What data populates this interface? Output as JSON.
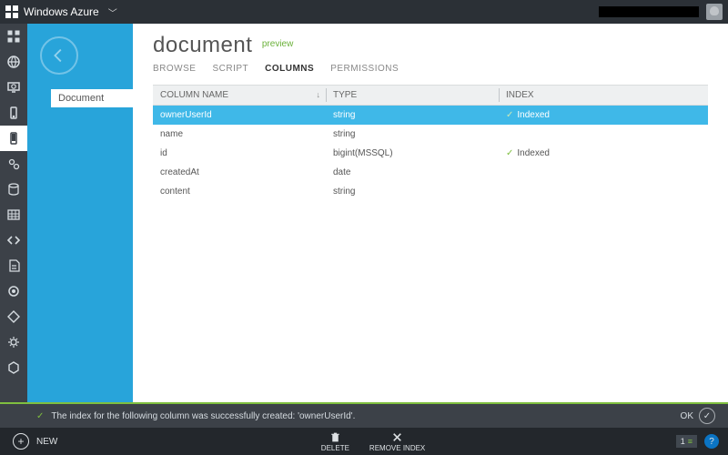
{
  "brand": "Windows Azure",
  "subrail": {
    "item": "Document"
  },
  "page": {
    "title": "document",
    "previewTag": "preview"
  },
  "tabs": [
    "BROWSE",
    "SCRIPT",
    "COLUMNS",
    "PERMISSIONS"
  ],
  "activeTab": 2,
  "columns": {
    "name": "COLUMN NAME",
    "type": "TYPE",
    "index": "INDEX"
  },
  "indexedLabel": "Indexed",
  "rows": [
    {
      "name": "ownerUserId",
      "type": "string",
      "indexed": true,
      "selected": true
    },
    {
      "name": "name",
      "type": "string",
      "indexed": false,
      "selected": false
    },
    {
      "name": "id",
      "type": "bigint(MSSQL)",
      "indexed": true,
      "selected": false
    },
    {
      "name": "createdAt",
      "type": "date",
      "indexed": false,
      "selected": false
    },
    {
      "name": "content",
      "type": "string",
      "indexed": false,
      "selected": false
    }
  ],
  "status": {
    "message": "The index for the following column was successfully created: 'ownerUserId'.",
    "ok": "OK"
  },
  "cmd": {
    "new": "NEW",
    "delete": "DELETE",
    "removeIndex": "REMOVE INDEX",
    "count": "1"
  },
  "icons": [
    "grid",
    "globe",
    "web-monitor",
    "mobile",
    "mobile-alt",
    "gears",
    "db",
    "table",
    "code",
    "script",
    "ring",
    "diamond",
    "gears2",
    "hex"
  ]
}
